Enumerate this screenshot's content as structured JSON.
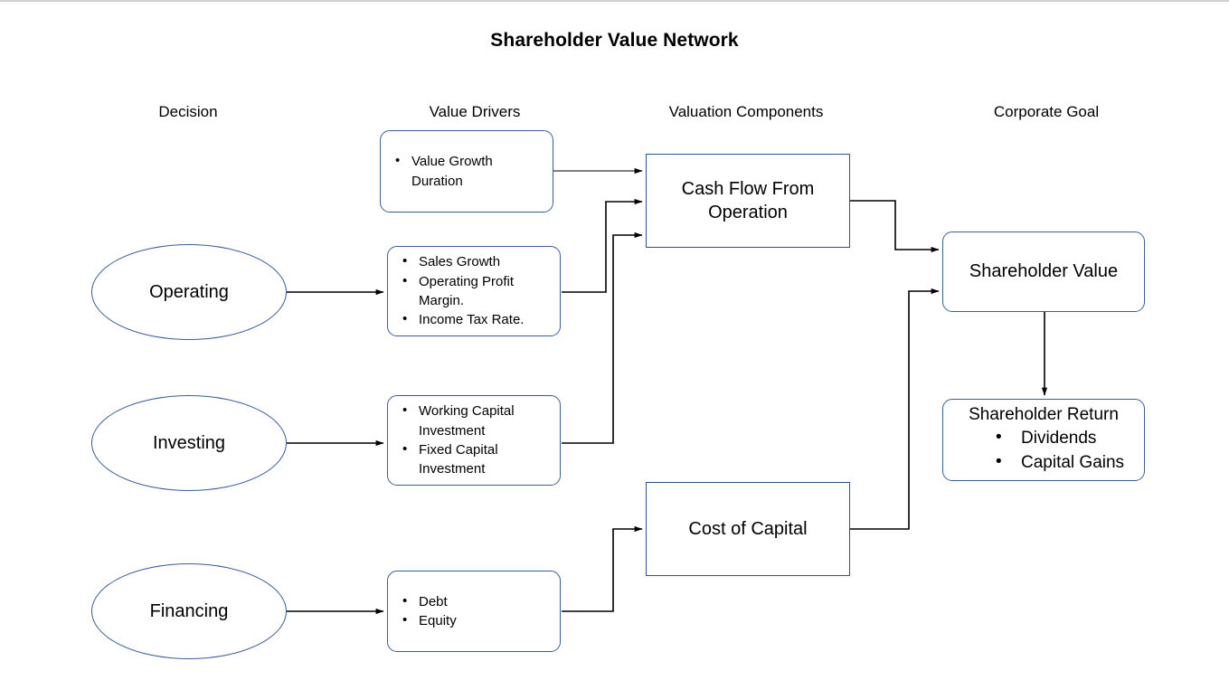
{
  "title": "Shareholder Value Network",
  "columns": [
    {
      "label": "Decision"
    },
    {
      "label": "Value Drivers"
    },
    {
      "label": "Valuation Components"
    },
    {
      "label": "Corporate Goal"
    }
  ],
  "decisions": [
    {
      "label": "Operating"
    },
    {
      "label": "Investing"
    },
    {
      "label": "Financing"
    }
  ],
  "value_drivers": [
    {
      "items": [
        "Value Growth Duration"
      ]
    },
    {
      "items": [
        "Sales Growth",
        "Operating Profit Margin.",
        "Income Tax Rate."
      ]
    },
    {
      "items": [
        "Working Capital Investment",
        "Fixed Capital Investment"
      ]
    },
    {
      "items": [
        "Debt",
        "Equity"
      ]
    }
  ],
  "valuation_components": [
    {
      "label": "Cash Flow From Operation"
    },
    {
      "label": "Cost of Capital"
    }
  ],
  "corporate_goal": {
    "value_label": "Shareholder Value",
    "return_heading": "Shareholder Return",
    "return_items": [
      "Dividends",
      "Capital Gains"
    ]
  },
  "colors": {
    "shape_border_blue": "#3a5c9a",
    "box_border_blue": "#2e5395",
    "connector": "#000000",
    "top_rule": "#d0d0d0",
    "background": "#ffffff",
    "text": "#000000"
  }
}
